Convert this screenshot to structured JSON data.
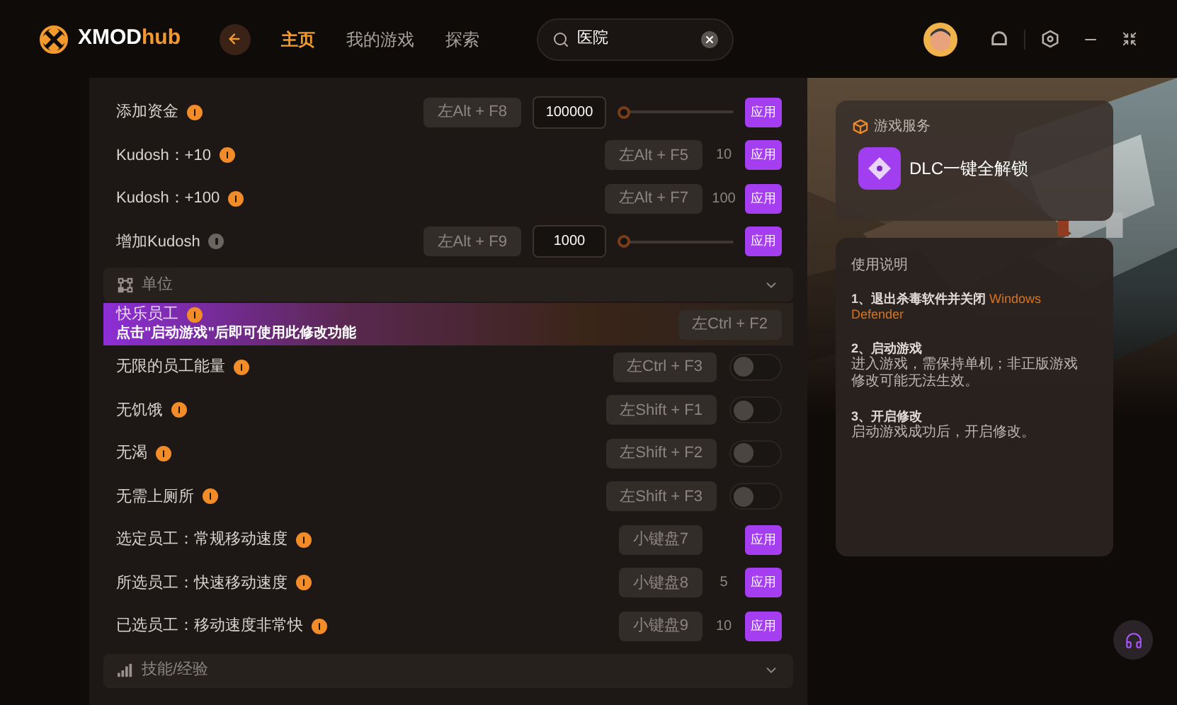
{
  "app": {
    "logo": "XMOD",
    "logo_accent": "hub"
  },
  "nav": [
    {
      "label": "主页",
      "selected": true
    },
    {
      "label": "我的游戏",
      "selected": false
    },
    {
      "label": "探索",
      "selected": false
    }
  ],
  "search": {
    "value": "医院"
  },
  "top_rows": [
    {
      "kind": "slider",
      "label": "添加资金",
      "color": "#f28c28",
      "hotkey": "左Alt + F8",
      "value": "100000",
      "level": 0,
      "action": "应用"
    },
    {
      "kind": "value",
      "label": "Kudosh：+10",
      "color": "#f28c28",
      "hotkey": "左Alt + F5",
      "amount": "10",
      "action": "应用"
    },
    {
      "kind": "value",
      "label": "Kudosh：+100",
      "color": "#f28c28",
      "hotkey": "左Alt + F7",
      "amount": "100",
      "action": "应用"
    },
    {
      "kind": "slider",
      "label": "增加Kudosh",
      "color": "#6b6560",
      "hotkey": "左Alt + F9",
      "value": "1000",
      "level": 0,
      "action": "应用"
    }
  ],
  "sections": [
    {
      "title": "单位",
      "kind": "units",
      "rows": [
        {
          "kind": "locked",
          "label": "快乐员工",
          "color": "#f28c28",
          "hint": "点击\"启动游戏\"后即可使用此修改功能",
          "hotkey": "左Ctrl + F2"
        },
        {
          "kind": "toggle",
          "label": "无限的员工能量",
          "color": "#f28c28",
          "hotkey": "左Ctrl + F3",
          "on": false
        },
        {
          "kind": "toggle",
          "label": "无饥饿",
          "color": "#f28c28",
          "hotkey": "左Shift + F1",
          "on": false
        },
        {
          "kind": "toggle",
          "label": "无渴",
          "color": "#f28c28",
          "hotkey": "左Shift + F2",
          "on": false
        },
        {
          "kind": "toggle",
          "label": "无需上厕所",
          "color": "#f28c28",
          "hotkey": "左Shift + F3",
          "on": false
        },
        {
          "kind": "value",
          "label": "选定员工：常规移动速度",
          "color": "#f28c28",
          "hotkey": "小键盘7",
          "action": "应用"
        },
        {
          "kind": "value",
          "label": "所选员工：快速移动速度",
          "color": "#f28c28",
          "hotkey": "小键盘8",
          "amount": "5",
          "action": "应用"
        },
        {
          "kind": "value",
          "label": "已选员工：移动速度非常快",
          "color": "#f28c28",
          "hotkey": "小键盘9",
          "amount": "10",
          "action": "应用"
        }
      ]
    },
    {
      "title": "技能/经验",
      "kind": "skills"
    }
  ],
  "service": {
    "title": "游戏服务",
    "item": "DLC一键全解锁"
  },
  "guide": {
    "title": "使用说明",
    "steps": [
      {
        "heading": "1、退出杀毒软件并关闭",
        "highlight": "Windows Defender"
      },
      {
        "heading": "2、启动游戏",
        "body": "进入游戏，需保持单机；非正版游戏修改可能无法生效。"
      },
      {
        "heading": "3、开启修改",
        "body": "启动游戏成功后，开启修改。"
      }
    ]
  }
}
